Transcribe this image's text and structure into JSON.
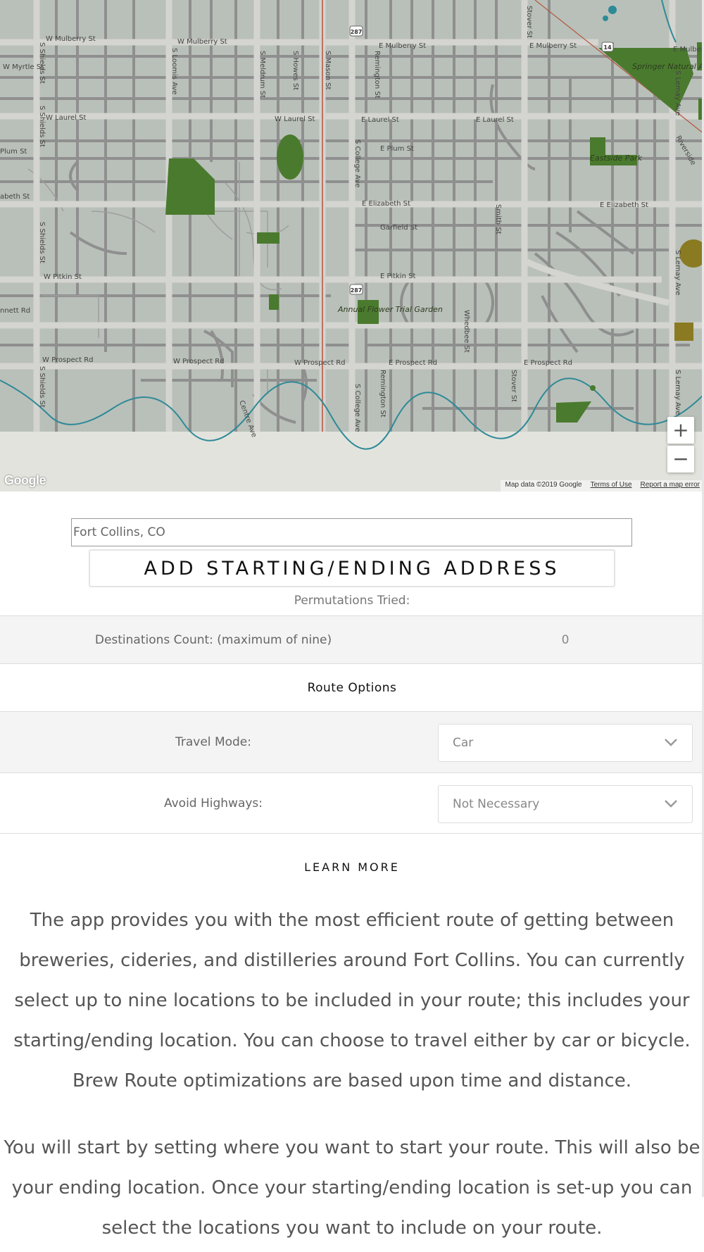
{
  "map": {
    "streets": {
      "mulberry_w1": "W Mulberry St",
      "mulberry_w2": "W Mulberry St",
      "mulberry_e1": "E Mulberry St",
      "mulberry_e2": "E Mulberry St",
      "mulberry_e3": "E Mulber",
      "laurel_w1": "W Laurel St",
      "laurel_w2": "W Laurel St",
      "laurel_e1": "E Laurel St",
      "laurel_e2": "E Laurel St",
      "elizabeth_e1": "E Elizabeth St",
      "elizabeth_e2": "E Elizabeth St",
      "elizabeth_w": "abeth St",
      "pitkin_w": "W Pitkin St",
      "pitkin_e": "E Pitkin St",
      "prospect_w1": "W Prospect Rd",
      "prospect_w2": "W Prospect Rd",
      "prospect_w3": "W Prospect Rd",
      "prospect_e1": "E Prospect Rd",
      "prospect_e2": "E Prospect Rd",
      "plum_w": "Plum St",
      "plum_e": "E Plum St",
      "myrtle": "W Myrtle St",
      "shields1": "S Shields St",
      "shields2": "S Shields St",
      "shields3": "S Shields St",
      "shields4": "S Shields St",
      "loomis": "S Loomis Ave",
      "meldrum": "S Meldrum St",
      "howes": "S Howes St",
      "mason": "S Mason St",
      "college1": "S College Ave",
      "college2": "S College Ave",
      "remington1": "Remington St",
      "remington2": "Remington St",
      "stover1": "Stover St",
      "stover2": "Stover St",
      "whedbee": "Whedbee St",
      "lemay1": "S Lemay Ave",
      "lemay2": "S Lemay Ave",
      "lemay3": "S Lemay Ave",
      "bennett": "nnett Rd",
      "centre": "Centre Ave",
      "prospect_lane": "Garfield St",
      "riverside": "Riverside",
      "smith": "Smith St"
    },
    "places": {
      "springer": "Springer Natural Area",
      "eastside": "Eastside Park",
      "annual_flower": "Annual Flower Trial Garden"
    },
    "shields": {
      "hwy287a": "287",
      "hwy287b": "287",
      "hwy14": "14"
    },
    "zoom_in": "+",
    "zoom_out": "−",
    "logo": "Google",
    "attribution": "Map data ©2019 Google",
    "terms": "Terms of Use",
    "report": "Report a map error"
  },
  "address": {
    "value": "Fort Collins, CO",
    "button_label": "ADD STARTING/ENDING ADDRESS"
  },
  "permutations_label": "Permutations Tried:",
  "table": {
    "destinations_label": "Destinations Count: (maximum of nine)",
    "destinations_value": "0",
    "route_options_title": "Route Options",
    "travel_mode_label": "Travel Mode:",
    "travel_mode_value": "Car",
    "avoid_highways_label": "Avoid Highways:",
    "avoid_highways_value": "Not Necessary"
  },
  "learn_more": {
    "title": "LEARN MORE",
    "paragraph1": "The app provides you with the most efficient route of getting between breweries, cideries, and distilleries around Fort Collins. You can currently select up to nine locations to be included in your route; this includes your starting/ending location. You can choose to travel either by car or bicycle. Brew Route optimizations are based upon time and distance.",
    "paragraph2": "You will start by setting where you want to start your route. This will also be your ending location. Once your starting/ending location is set-up you can select the locations you want to include on your route."
  },
  "colors": {
    "map_bg": "#b9c0b9",
    "road": "#8f8f8f",
    "park": "#4a7a2e",
    "water": "#2e8a97",
    "rail": "#b5533c"
  }
}
